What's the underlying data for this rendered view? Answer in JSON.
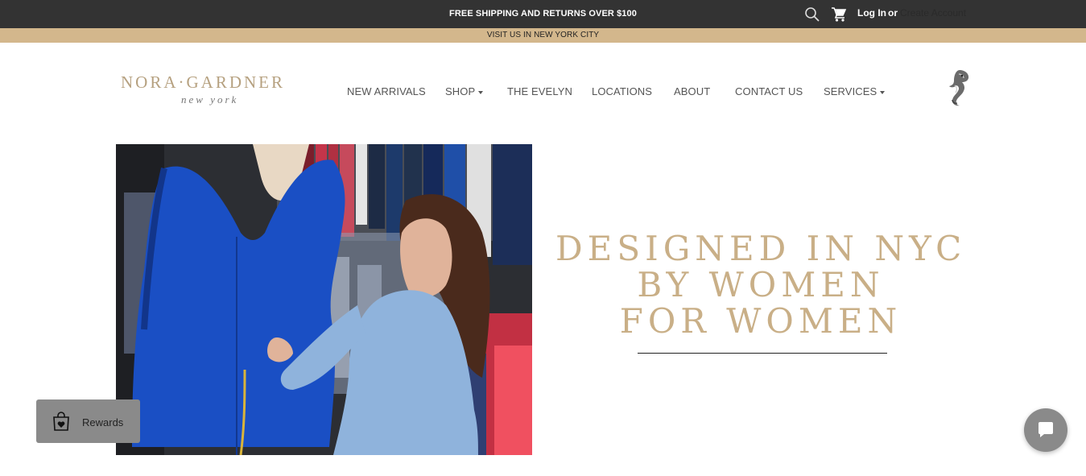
{
  "topbar": {
    "announcement": "FREE SHIPPING AND RETURNS OVER $100",
    "search_icon": "search-icon",
    "cart_icon": "cart-icon",
    "login_label": "Log In",
    "or_label": "or",
    "create_account_label": "Create Account"
  },
  "visitbar": {
    "text": "VISIT US IN NEW YORK CITY"
  },
  "logo": {
    "name": "NORA·GARDNER",
    "tagline": "new york"
  },
  "nav": {
    "items": [
      {
        "label": "NEW ARRIVALS"
      },
      {
        "label": "SHOP"
      },
      {
        "label": "THE EVELYN"
      },
      {
        "label": "LOCATIONS"
      },
      {
        "label": "ABOUT"
      },
      {
        "label": "CONTACT US"
      },
      {
        "label": "SERVICES"
      }
    ]
  },
  "hero": {
    "headline_line1": "DESIGNED IN NYC",
    "headline_line2": "BY WOMEN",
    "headline_line3": "FOR WOMEN"
  },
  "rewards": {
    "label": "Rewards",
    "icon": "shopping-bag-heart-icon"
  },
  "chat": {
    "icon": "chat-bubble-icon"
  },
  "colors": {
    "topbar": "#333333",
    "visitbar": "#d3b78c",
    "gold_text": "#c9af87",
    "widget_gray": "#8a8a8a"
  }
}
